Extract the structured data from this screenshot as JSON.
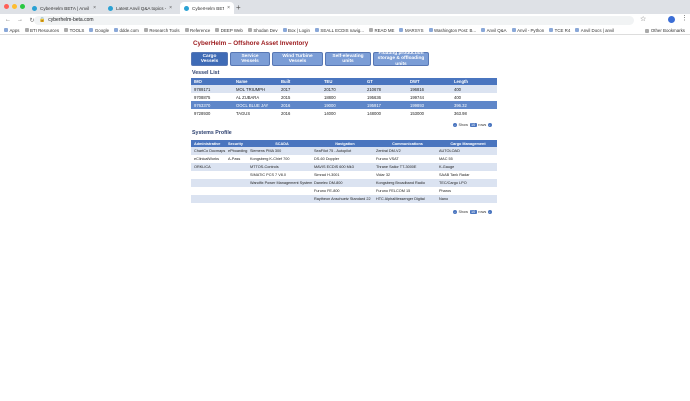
{
  "browser": {
    "tabs": [
      {
        "title": "CyberHelm BETA | Anvil",
        "active": false
      },
      {
        "title": "Latest Anvil Q&A topics - Anvil",
        "active": false
      },
      {
        "title": "CyberHelm BETA",
        "active": true
      }
    ],
    "url": "cyberhelm-beta.com",
    "bookmarks": [
      "Apps",
      "BTI Resources",
      "TOOLS",
      "Google",
      "ddde.com",
      "Research Tools",
      "Reference",
      "DEEP Web",
      "Shodan Dev",
      "Box | Login",
      "SEALL ECDIS navig...",
      "READ ME",
      "MARSYS",
      "Washington Post: B...",
      "Anvil Q&A",
      "Anvil - Python",
      "TCE R4",
      "Anvil Docs | anvil"
    ],
    "other_bookmarks": "Other Bookmarks"
  },
  "page": {
    "title": "CyberHelm – Offshore Asset Inventory",
    "nav_buttons": [
      {
        "label": "Cargo Vessels",
        "active": true
      },
      {
        "label": "Service Vessels",
        "active": false
      },
      {
        "label": "Wind Turbine Vessels",
        "active": false
      },
      {
        "label": "Self-elevating units",
        "active": false
      },
      {
        "label": "Floating production storage & offloading units",
        "active": false
      }
    ]
  },
  "vessel_list": {
    "title": "Vessel List",
    "headers": [
      "IMO",
      "Name",
      "Built",
      "TEU",
      "GT",
      "DWT",
      "Length"
    ],
    "rows": [
      [
        "9789171",
        "MOL TRIUMPH",
        "2017",
        "20170",
        "210678",
        "196816",
        "400"
      ],
      [
        "9708875",
        "AL ZUBARA",
        "2015",
        "18800",
        "195636",
        "199744",
        "400"
      ],
      [
        "9763370",
        "OOCL BLUE JAY",
        "2016",
        "19000",
        "195917",
        "199893",
        "396.32"
      ],
      [
        "9728930",
        "TAGUS",
        "2016",
        "14000",
        "148000",
        "153000",
        "363.98"
      ]
    ],
    "selected_row": 2,
    "pager": {
      "prefix": "Show",
      "count": "10",
      "suffix": "rows"
    }
  },
  "systems_profile": {
    "title": "Systems Profile",
    "headers": [
      "Administrative",
      "Security",
      "SCADA",
      "Navigation",
      "Communications",
      "Cargo Management"
    ],
    "rows": [
      [
        "ChartCo Docmaps",
        "ePboarding",
        "Siemens PMA 300",
        "SeaFilot 75 - Autopilot",
        "Zentral DM-V2",
        "AUTOLOAD"
      ],
      [
        "eClinicalWorks",
        "A-Pass",
        "Kongsberg K-Chief 700",
        "DS-60 Doppler",
        "Furuno VSAT",
        "MAC 55"
      ],
      [
        "ORKLICA",
        "",
        "MTTOS-Controls",
        "MAVIS ECDIS 600 Mk3",
        "Thrane Sailor TT-3000E",
        "K-Gauge"
      ],
      [
        "",
        "",
        "SIMATIC PCS 7 V8.0",
        "Simrad H-3001",
        "Vidar 32",
        "SAAB Tank Radar"
      ],
      [
        "",
        "",
        "Wandfix Power Management System",
        "Danelec DM-800",
        "Kongsberg Broadband Radio",
        "TEC/Cargo LPO"
      ],
      [
        "",
        "",
        "",
        "Furuno FE-800",
        "Furuno FELCOM 15",
        "Pharos"
      ],
      [
        "",
        "",
        "",
        "Raytheon Anschuetz Standard 22",
        "HTC AlphaMessenger Digital",
        "Nano"
      ]
    ],
    "pager": {
      "prefix": "Show",
      "count": "10",
      "suffix": "rows"
    }
  },
  "colors": {
    "title": "#9d1d20",
    "header": "#4a75bf",
    "nav_button": "#7b9dd6",
    "nav_button_active": "#3f6bb6",
    "selected_row": "#5f87c9"
  }
}
